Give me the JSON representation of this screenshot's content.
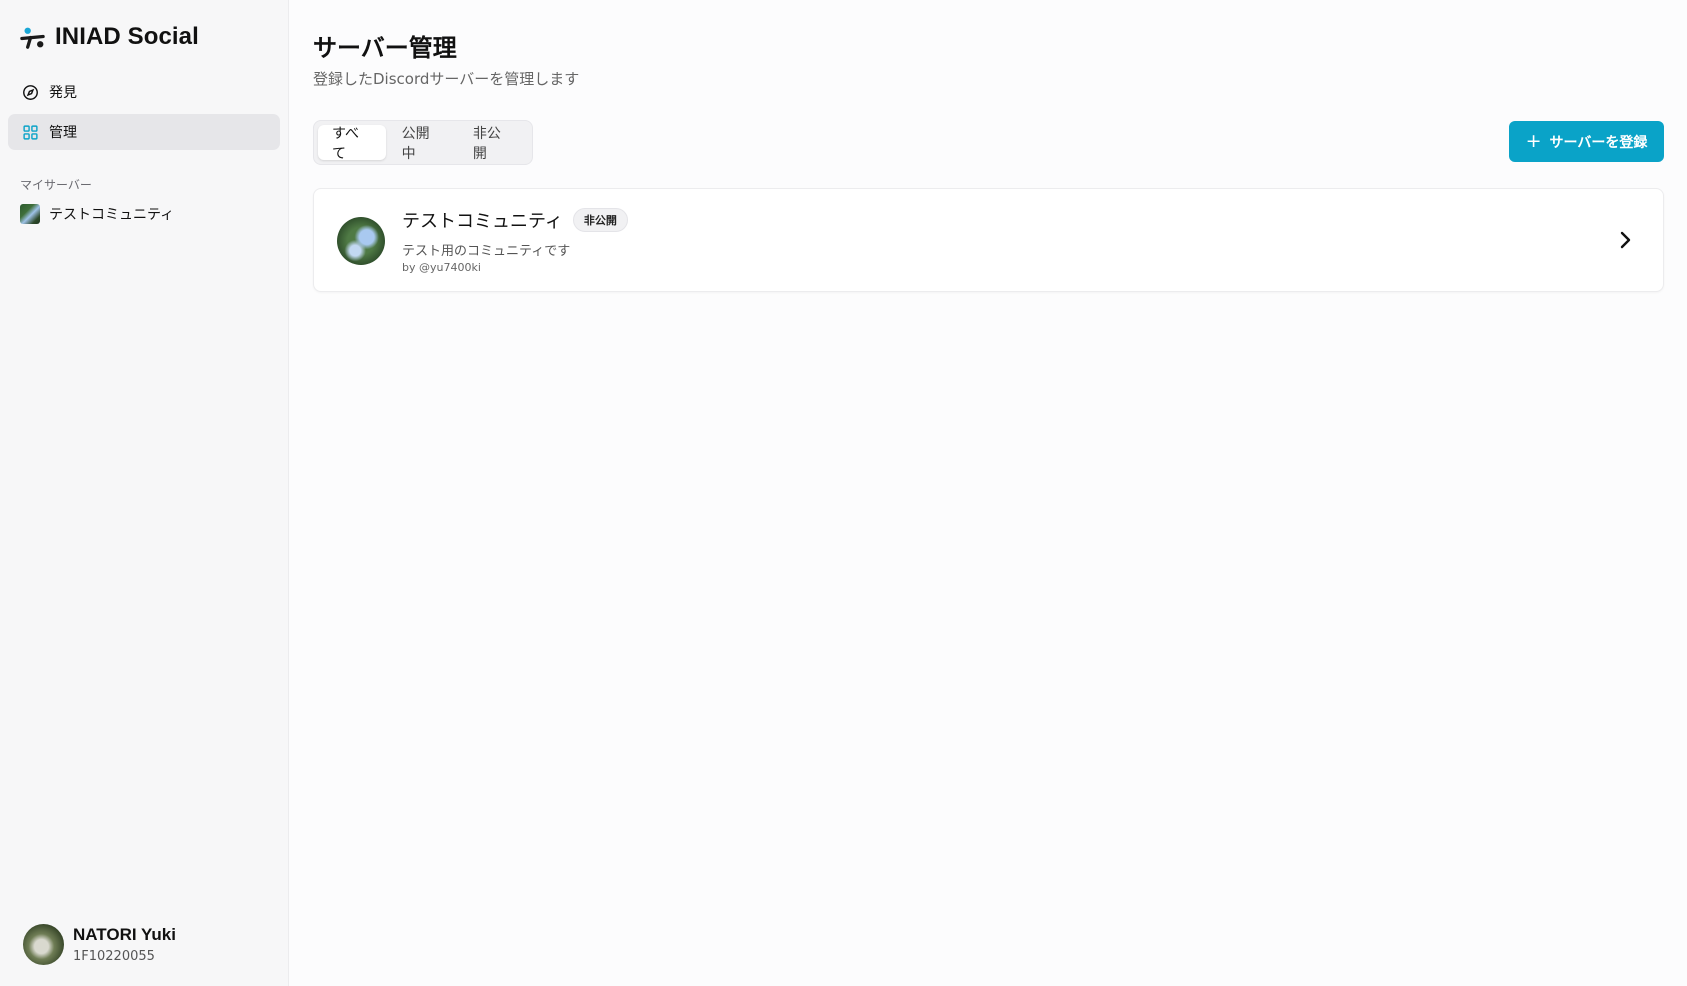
{
  "brand": {
    "name": "INIAD Social",
    "logo": "iniad-logo-icon",
    "accent": "#0aa3c8"
  },
  "nav": {
    "discover_label": "発見",
    "discover_icon": "compass-icon",
    "manage_label": "管理",
    "manage_icon": "grid-icon"
  },
  "sidebar": {
    "section_label": "マイサーバー",
    "servers": [
      {
        "name": "テストコミュニティ"
      }
    ]
  },
  "user": {
    "name": "NATORI Yuki",
    "id": "1F10220055"
  },
  "page": {
    "title": "サーバー管理",
    "subtitle": "登録したDiscordサーバーを管理します"
  },
  "tabs": [
    {
      "label": "すべて",
      "active": true
    },
    {
      "label": "公開中",
      "active": false
    },
    {
      "label": "非公開",
      "active": false
    }
  ],
  "register_button": {
    "label": "サーバーを登録",
    "icon": "plus-icon"
  },
  "server_list": [
    {
      "name": "テストコミュニティ",
      "badge": "非公開",
      "description": "テスト用のコミュニティです",
      "owner": "by @yu7400ki"
    }
  ]
}
